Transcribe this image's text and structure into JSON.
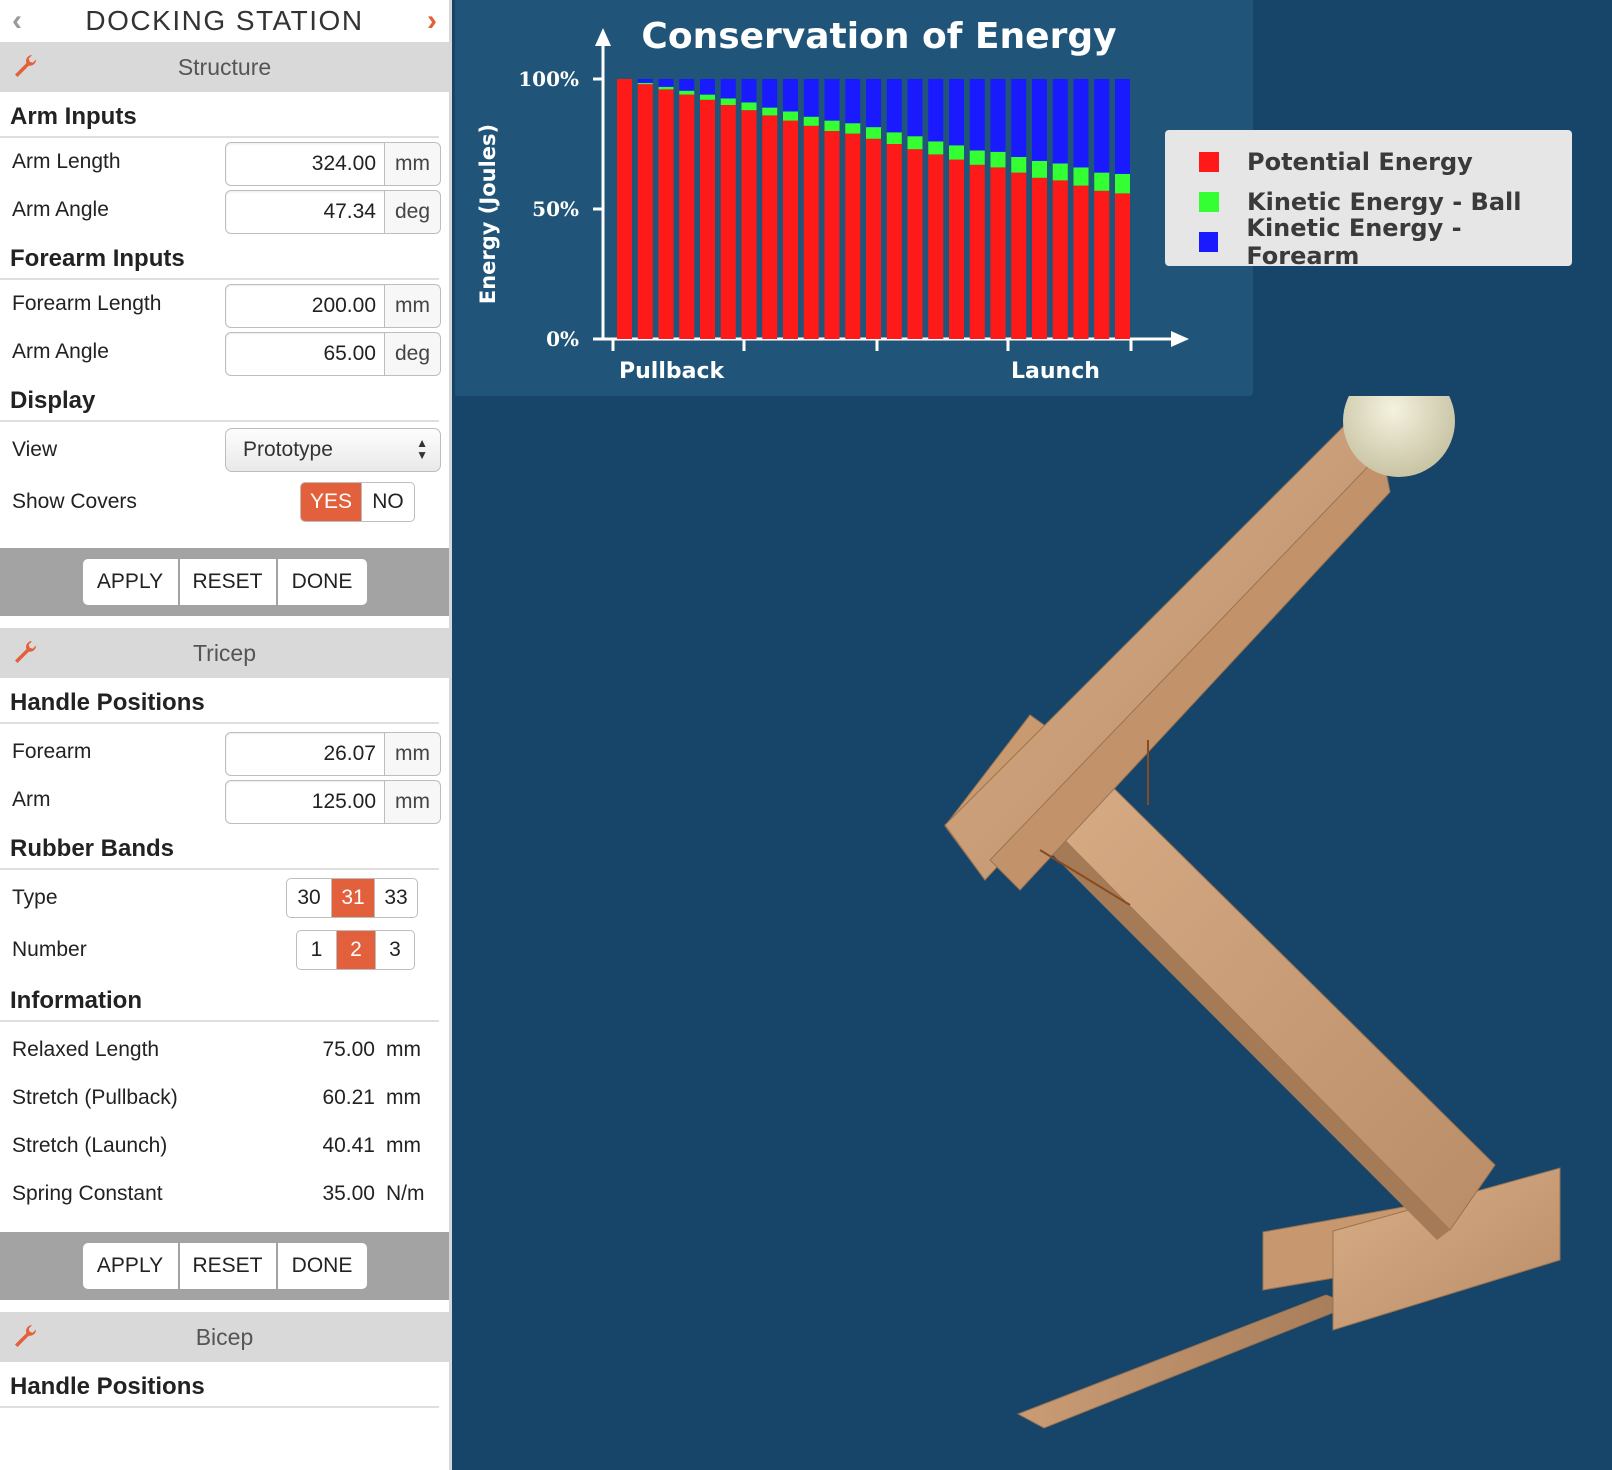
{
  "sidebar": {
    "title": "DOCKING STATION",
    "structure": {
      "header": "Structure",
      "arm_inputs_title": "Arm Inputs",
      "arm_length": {
        "label": "Arm Length",
        "value": "324.00",
        "unit": "mm"
      },
      "arm_angle": {
        "label": "Arm Angle",
        "value": "47.34",
        "unit": "deg"
      },
      "forearm_inputs_title": "Forearm Inputs",
      "forearm_length": {
        "label": "Forearm Length",
        "value": "200.00",
        "unit": "mm"
      },
      "forearm_angle": {
        "label": "Arm Angle",
        "value": "65.00",
        "unit": "deg"
      },
      "display_title": "Display",
      "view": {
        "label": "View",
        "value": "Prototype"
      },
      "show_covers": {
        "label": "Show Covers",
        "yes": "YES",
        "no": "NO",
        "selected": "YES"
      }
    },
    "tricep": {
      "header": "Tricep",
      "handle_positions_title": "Handle Positions",
      "forearm": {
        "label": "Forearm",
        "value": "26.07",
        "unit": "mm"
      },
      "arm": {
        "label": "Arm",
        "value": "125.00",
        "unit": "mm"
      },
      "rubber_bands_title": "Rubber Bands",
      "type": {
        "label": "Type",
        "options": [
          "30",
          "31",
          "33"
        ],
        "selected": "31"
      },
      "number": {
        "label": "Number",
        "options": [
          "1",
          "2",
          "3"
        ],
        "selected": "2"
      },
      "information_title": "Information",
      "relaxed_length": {
        "label": "Relaxed Length",
        "value": "75.00",
        "unit": "mm"
      },
      "stretch_pullback": {
        "label": "Stretch (Pullback)",
        "value": "60.21",
        "unit": "mm"
      },
      "stretch_launch": {
        "label": "Stretch (Launch)",
        "value": "40.41",
        "unit": "mm"
      },
      "spring_constant": {
        "label": "Spring Constant",
        "value": "35.00",
        "unit": "N/m"
      }
    },
    "bicep": {
      "header": "Bicep",
      "handle_positions_title": "Handle Positions"
    },
    "buttons": {
      "apply": "APPLY",
      "reset": "RESET",
      "done": "DONE"
    }
  },
  "chart_data": {
    "type": "bar",
    "stacked": true,
    "title": "Conservation of Energy",
    "ylabel": "Energy (Joules)",
    "xlabel": "",
    "x_tick_labels": {
      "start": "Pullback",
      "end": "Launch"
    },
    "y_ticks": [
      "0%",
      "50%",
      "100%"
    ],
    "ylim": [
      0,
      100
    ],
    "series": [
      {
        "name": "Potential Energy",
        "color": "#ff1a1a",
        "values": [
          100,
          98,
          96,
          94,
          92,
          90,
          88,
          86,
          84,
          82,
          80,
          79,
          77,
          75,
          73,
          71,
          69,
          67,
          66,
          64,
          62,
          61,
          59,
          57,
          56
        ]
      },
      {
        "name": "Kinetic Energy - Ball",
        "color": "#33ff33",
        "values": [
          0,
          0.5,
          1,
          1.5,
          2,
          2.5,
          3,
          3,
          3.5,
          3.5,
          4,
          4,
          4.5,
          4.5,
          5,
          5,
          5.5,
          5.5,
          6,
          6,
          6.5,
          6.5,
          7,
          7,
          7.5
        ]
      },
      {
        "name": "Kinetic Energy - Forearm",
        "color": "#1a1aff",
        "values": [
          0,
          1.5,
          3,
          4.5,
          6,
          7.5,
          9,
          11,
          12.5,
          14.5,
          16,
          17,
          18.5,
          20.5,
          22,
          24,
          25.5,
          27.5,
          28,
          30,
          31.5,
          32.5,
          34,
          36,
          36.5
        ]
      }
    ]
  }
}
